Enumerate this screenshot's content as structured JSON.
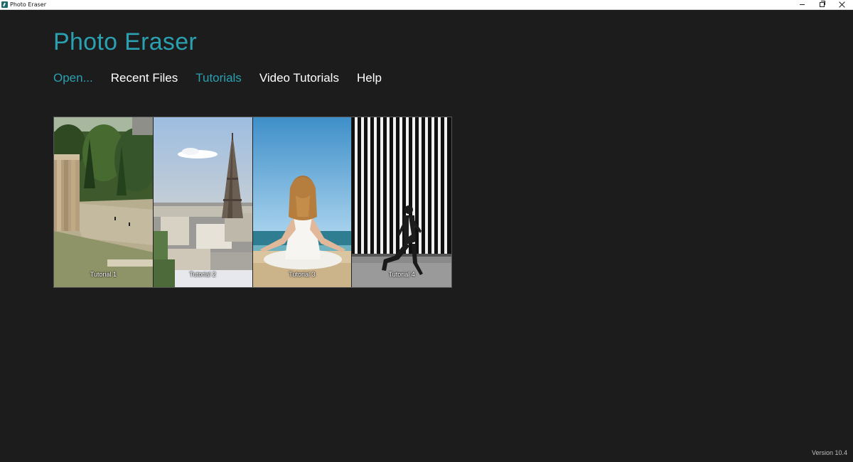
{
  "window": {
    "title": "Photo Eraser",
    "icon": "app-icon"
  },
  "header": {
    "app_title": "Photo Eraser"
  },
  "nav": {
    "items": [
      {
        "label": "Open...",
        "accent": true
      },
      {
        "label": "Recent Files",
        "accent": false
      },
      {
        "label": "Tutorials",
        "accent": true
      },
      {
        "label": "Video Tutorials",
        "accent": false
      },
      {
        "label": "Help",
        "accent": false
      }
    ]
  },
  "tutorials": [
    {
      "label": "Tutorial 1",
      "image": "ancient-ruins-landscape"
    },
    {
      "label": "Tutorial 2",
      "image": "eiffel-tower-cityscape"
    },
    {
      "label": "Tutorial 3",
      "image": "woman-meditating-beach"
    },
    {
      "label": "Tutorial 4",
      "image": "man-running-striped-wall"
    }
  ],
  "footer": {
    "version": "Version 10.4"
  },
  "colors": {
    "accent": "#2aa0b0",
    "background": "#1c1c1c",
    "text": "#ffffff"
  }
}
